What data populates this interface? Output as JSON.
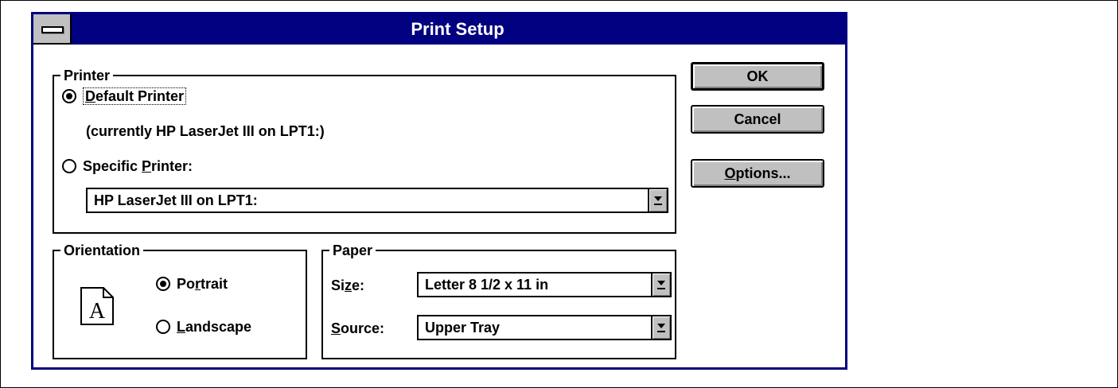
{
  "dialog": {
    "title": "Print Setup"
  },
  "printer": {
    "legend": "Printer",
    "default_label": "Default Printer",
    "default_selected": true,
    "current_text": "(currently HP LaserJet III on LPT1:)",
    "specific_label": "Specific Printer:",
    "specific_selected": false,
    "specific_value": "HP LaserJet III on LPT1:"
  },
  "orientation": {
    "legend": "Orientation",
    "icon_letter": "A",
    "portrait_label": "Portrait",
    "portrait_selected": true,
    "landscape_label": "Landscape",
    "landscape_selected": false
  },
  "paper": {
    "legend": "Paper",
    "size_label": "Size:",
    "size_value": "Letter 8 1/2 x 11 in",
    "source_label": "Source:",
    "source_value": "Upper Tray"
  },
  "buttons": {
    "ok": "OK",
    "cancel": "Cancel",
    "options": "Options..."
  },
  "colors": {
    "titlebar": "#000080",
    "button_face": "#c0c0c0"
  }
}
